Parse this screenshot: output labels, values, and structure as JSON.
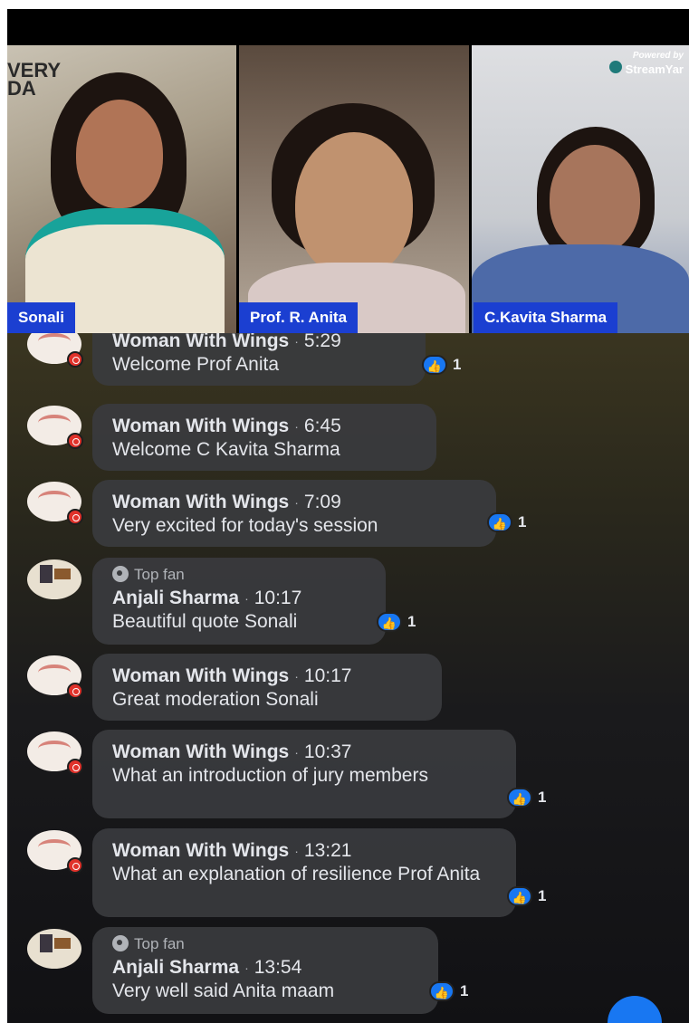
{
  "stream": {
    "powered_by": "Powered by",
    "logo": "StreamYar",
    "wall_text": "VERY\nDA"
  },
  "participants": [
    {
      "name": "Sonali"
    },
    {
      "name": "Prof. R. Anita"
    },
    {
      "name": "C.Kavita Sharma"
    }
  ],
  "comments": [
    {
      "author": "Woman With Wings",
      "time": "5:29",
      "text": "Welcome Prof Anita",
      "likes": "1",
      "top_fan": ""
    },
    {
      "author": "Woman With Wings",
      "time": "6:45",
      "text": "Welcome C Kavita Sharma",
      "likes": "",
      "top_fan": ""
    },
    {
      "author": "Woman With Wings",
      "time": "7:09",
      "text": "Very excited for today's session",
      "likes": "1",
      "top_fan": ""
    },
    {
      "author": "Anjali Sharma",
      "time": "10:17",
      "text": "Beautiful quote Sonali",
      "likes": "1",
      "top_fan": "Top fan"
    },
    {
      "author": "Woman With Wings",
      "time": "10:17",
      "text": "Great moderation Sonali",
      "likes": "",
      "top_fan": ""
    },
    {
      "author": "Woman With Wings",
      "time": "10:37",
      "text": "What an introduction of jury members",
      "likes": "1",
      "top_fan": ""
    },
    {
      "author": "Woman With Wings",
      "time": "13:21",
      "text": "What an explanation of resilience Prof Anita",
      "likes": "1",
      "top_fan": ""
    },
    {
      "author": "Anjali Sharma",
      "time": "13:54",
      "text": "Very well said Anita maam",
      "likes": "1",
      "top_fan": "Top fan"
    }
  ],
  "separator": "·",
  "colors": {
    "name_tag": "#1b3fd1",
    "bubble": "#3a3b3e",
    "like": "#1877f2",
    "live_badge": "#e0322b"
  }
}
